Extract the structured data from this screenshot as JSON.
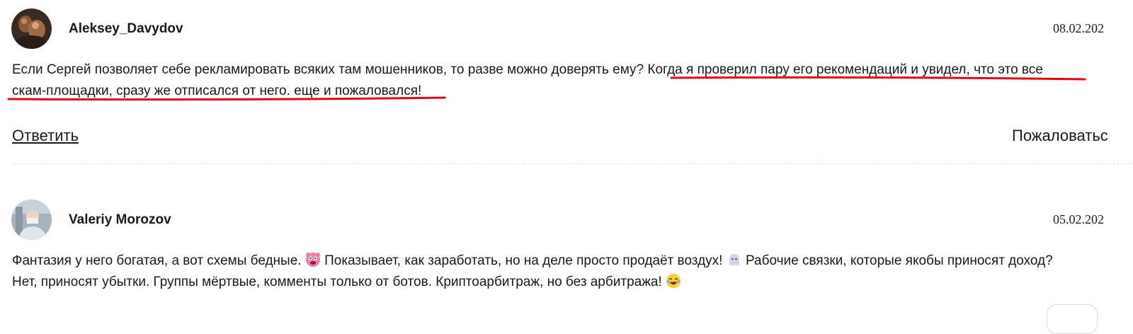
{
  "comments": [
    {
      "author": "Aleksey_Davydov",
      "date": "08.02.202",
      "text_plain": "Если Сергей позволяет себе рекламировать всяких там мошенников, то разве можно доверять ему? ",
      "text_marked_line1": "Когда я проверил пару его рекомендаций и увидел, что это все",
      "text_marked_line2": "скам-площадки, сразу же отписался от него. еще и пожаловался!",
      "reply_label": "Ответить",
      "report_label": "Пожаловатьс"
    },
    {
      "author": "Valeriy Morozov",
      "date": "05.02.202",
      "line1_part1": "Фантазия у него богатая, а вот схемы бедные. ",
      "line1_part2": " Показывает, как заработать, но на деле просто продаёт воздух! ",
      "line1_part3": " Рабочие связки, которые якобы приносят доход?",
      "line2_part1": "Нет, приносят убытки. Группы мёртвые, комменты только от ботов. Криптоарбитраж, но без арбитража! "
    }
  ],
  "icons": {
    "emoji_1": "monster-face-emoji",
    "emoji_2": "ghost-emoji",
    "emoji_3": "laughing-emoji"
  },
  "colors": {
    "annotation": "#e30613",
    "divider": "#e2e2e2"
  }
}
